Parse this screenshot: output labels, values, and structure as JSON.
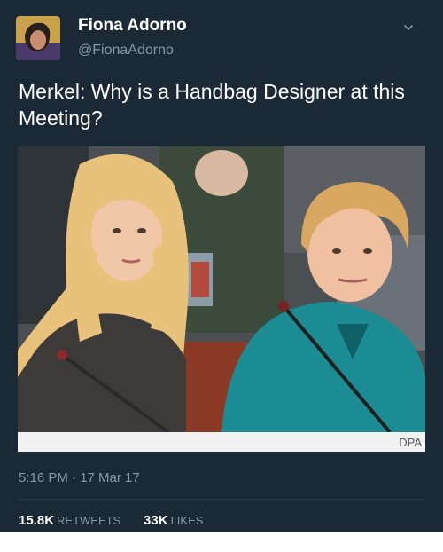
{
  "tweet": {
    "author": {
      "display_name": "Fiona Adorno",
      "handle": "@FionaAdorno"
    },
    "text": "Merkel: Why is a Handbag Designer at this Meeting?",
    "media": {
      "photo_credit": "DPA"
    },
    "timestamp": "5:16 PM · 17 Mar 17",
    "stats": {
      "retweets_count": "15.8K",
      "retweets_label": "RETWEETS",
      "likes_count": "33K",
      "likes_label": "LIKES"
    }
  },
  "icons": {
    "menu": "chevron-down-icon"
  },
  "colors": {
    "card_background": "#1b2836",
    "secondary_text": "#8899a6",
    "primary_text": "#ffffff"
  }
}
